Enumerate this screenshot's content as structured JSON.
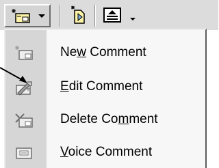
{
  "toolbar": {
    "buttons": [
      {
        "name": "new-comment",
        "icon": "comment-icon",
        "has_dropdown": true
      },
      {
        "name": "navigate",
        "icon": "next-comment-icon",
        "has_dropdown": false
      },
      {
        "name": "share",
        "icon": "align-icon",
        "has_dropdown": true
      }
    ]
  },
  "menu": {
    "items": [
      {
        "label_before": "Ne",
        "label_accel": "w",
        "label_after": " Comment",
        "icon": "new-comment-icon"
      },
      {
        "label_before": "",
        "label_accel": "E",
        "label_after": "dit Comment",
        "icon": "edit-comment-icon"
      },
      {
        "label_before": "Delete Co",
        "label_accel": "m",
        "label_after": "ment",
        "icon": "delete-comment-icon"
      },
      {
        "label_before": "",
        "label_accel": "V",
        "label_after": "oice Comment",
        "icon": "voice-comment-icon"
      }
    ]
  },
  "colors": {
    "toolbar_bg": "#dcdcdc",
    "menu_bg": "#f7f7f7",
    "gutter_bg": "#d6d6d6"
  }
}
